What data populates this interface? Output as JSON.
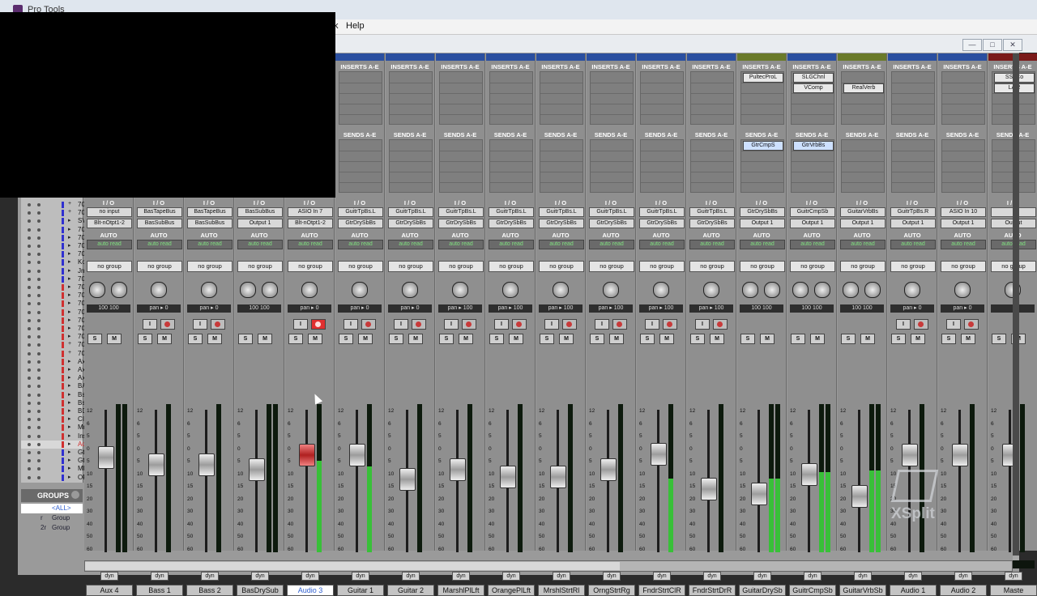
{
  "app": {
    "title": "Pro Tools",
    "menu_help": "Help",
    "menu_prev_char": "k"
  },
  "window_buttons": {
    "minimize": "—",
    "restore": "□",
    "close": "✕"
  },
  "section_headers": {
    "inserts": "INSERTS A-E",
    "sends": "SENDS A-E",
    "io": "I / O",
    "auto": "AUTO"
  },
  "auto_mode": "auto read",
  "group_label": "no group",
  "button_labels": {
    "input": "I",
    "solo": "S",
    "mute": "M"
  },
  "dyn_label": "dyn",
  "colors": {
    "accent_blue": "#2a4fa0",
    "meter_green": "#38c038",
    "selected_red": "#d03030",
    "olive": "#6a7a2a",
    "maroon": "#7a1a1a"
  },
  "track_list": [
    {
      "name": "700",
      "color": "#3030d0",
      "marker": "+"
    },
    {
      "name": "700",
      "color": "#3030d0",
      "marker": "+"
    },
    {
      "name": "SV",
      "color": "#3030d0",
      "marker": "▸"
    },
    {
      "name": "700",
      "color": "#3030d0",
      "marker": "▸"
    },
    {
      "name": "700",
      "color": "#3030d0",
      "marker": "▸"
    },
    {
      "name": "700",
      "color": "#3030d0",
      "marker": "▸"
    },
    {
      "name": "700",
      "color": "#3030d0",
      "marker": "▸"
    },
    {
      "name": "KcF",
      "color": "#3030d0",
      "marker": "▸"
    },
    {
      "name": "JnK",
      "color": "#3030d0",
      "marker": "▸"
    },
    {
      "name": "700",
      "color": "#3030d0",
      "marker": "▸"
    },
    {
      "name": "700",
      "color": "#d03030",
      "marker": "▸"
    },
    {
      "name": "700",
      "color": "#d03030",
      "marker": "▸"
    },
    {
      "name": "700",
      "color": "#d03030",
      "marker": "▸"
    },
    {
      "name": "700",
      "color": "#d03030",
      "marker": "▸"
    },
    {
      "name": "700",
      "color": "#d03030",
      "marker": "▸"
    },
    {
      "name": "700",
      "color": "#d03030",
      "marker": "▸"
    },
    {
      "name": "700",
      "color": "#d03030",
      "marker": "▸"
    },
    {
      "name": "700",
      "color": "#d03030",
      "marker": "+"
    },
    {
      "name": "700",
      "color": "#d03030",
      "marker": "+"
    },
    {
      "name": "Ax2",
      "color": "#d03030",
      "marker": "▸"
    },
    {
      "name": "Ax3",
      "color": "#d03030",
      "marker": "▸"
    },
    {
      "name": "Ax4",
      "color": "#d03030",
      "marker": "▸"
    },
    {
      "name": "BA",
      "color": "#d03030",
      "marker": "▸"
    },
    {
      "name": "Bs1",
      "color": "#d03030",
      "marker": "▸"
    },
    {
      "name": "Bs2",
      "color": "#d03030",
      "marker": "▸"
    },
    {
      "name": "BD",
      "color": "#d03030",
      "marker": "▸"
    },
    {
      "name": "CIF",
      "color": "#d03030",
      "marker": "▸"
    },
    {
      "name": "MrV",
      "color": "#d03030",
      "marker": "▸"
    },
    {
      "name": "Ins4",
      "color": "#d03030",
      "marker": "▸"
    },
    {
      "name": "Ad3",
      "color": "#d03030",
      "marker": "▸"
    },
    {
      "name": "Gt1",
      "color": "#3030d0",
      "marker": "▸"
    },
    {
      "name": "Gt2",
      "color": "#3030d0",
      "marker": "▸"
    },
    {
      "name": "MP",
      "color": "#3030d0",
      "marker": "▸"
    },
    {
      "name": "OP",
      "color": "#3030d0",
      "marker": "▸"
    }
  ],
  "groups": {
    "title": "GROUPS",
    "items": [
      {
        "id": "",
        "name": "<ALL>"
      },
      {
        "id": "r",
        "name": "Group"
      },
      {
        "id": "2r",
        "name": "Group"
      }
    ]
  },
  "strips": [
    {
      "name": "Aux 4",
      "top_color": "#2a4fa0",
      "input": "no input",
      "output": "Blt-nOtpt1-2",
      "pan_text": "100  100",
      "stereo": true,
      "fader": 0.3,
      "meter": 0.0,
      "vol_left": "0.0",
      "vol_right": "",
      "inserts": [],
      "sends": [],
      "has_rec": false,
      "selected": false
    },
    {
      "name": "Bass 1",
      "top_color": "#2a4fa0",
      "input": "BasTapeBus",
      "output": "BasSubBus",
      "pan_text": "pan ▸ 0",
      "stereo": false,
      "fader": 0.36,
      "meter": 0.0,
      "vol_left": "-4.6",
      "vol_right": "-0.9",
      "inserts": [],
      "sends": [],
      "has_rec": true,
      "selected": false
    },
    {
      "name": "Bass 2",
      "top_color": "#2a4fa0",
      "input": "BasTapeBus",
      "output": "BasSubBus",
      "pan_text": "pan ▸ 0",
      "stereo": false,
      "fader": 0.36,
      "meter": 0.0,
      "vol_left": "-4.9",
      "vol_right": "-5.7",
      "inserts": [],
      "sends": [],
      "has_rec": true,
      "selected": false
    },
    {
      "name": "BasDrySub",
      "top_color": "#2a4fa0",
      "input": "BasSubBus",
      "output": "Output 1",
      "pan_text": "100  100",
      "stereo": true,
      "fader": 0.4,
      "meter": 0.0,
      "vol_left": "-5.9",
      "vol_right": "-1.4",
      "inserts": [],
      "sends": [],
      "has_rec": false,
      "selected": false
    },
    {
      "name": "Audio 3",
      "top_color": "#2a4fa0",
      "input": "ASIO In 7",
      "output": "Blt-nOtpt1-2",
      "pan_text": "pan ▸ 0",
      "stereo": false,
      "fader": 0.28,
      "meter": 0.62,
      "vol_left": "-0.4",
      "vol_right": "-0.0",
      "inserts": [],
      "sends": [],
      "has_rec": true,
      "rec_on": true,
      "selected": true
    },
    {
      "name": "Guitar 1",
      "top_color": "#2a4fa0",
      "input": "GuitrTpBs.L",
      "output": "GtrDrySbBs",
      "pan_text": "pan ▸ 0",
      "stereo": false,
      "fader": 0.28,
      "meter": 0.58,
      "vol_left": "-0.1",
      "vol_right": "-5.1",
      "inserts": [],
      "sends": [],
      "has_rec": true,
      "selected": false
    },
    {
      "name": "Guitar 2",
      "top_color": "#2a4fa0",
      "input": "GuitrTpBs.L",
      "output": "GtrDrySbBs",
      "pan_text": "pan ▸ 0",
      "stereo": false,
      "fader": 0.48,
      "meter": 0.0,
      "vol_left": "-12.9",
      "vol_right": "-5.1",
      "inserts": [],
      "sends": [],
      "has_rec": true,
      "selected": false
    },
    {
      "name": "MarshlPlLft",
      "top_color": "#2a4fa0",
      "input": "GuitrTpBs.L",
      "output": "GtrDrySbBs",
      "pan_text": "pan ▸ 100",
      "stereo": false,
      "fader": 0.4,
      "meter": 0.0,
      "vol_left": "-7.0",
      "vol_right": "-3.4",
      "inserts": [],
      "sends": [],
      "has_rec": true,
      "selected": false
    },
    {
      "name": "OrangePlLft",
      "top_color": "#2a4fa0",
      "input": "GuitrTpBs.L",
      "output": "GtrDrySbBs",
      "pan_text": "pan ▸ 100",
      "stereo": false,
      "fader": 0.46,
      "meter": 0.0,
      "vol_left": "-14.0",
      "vol_right": "-4.4",
      "inserts": [],
      "sends": [],
      "has_rec": true,
      "selected": false
    },
    {
      "name": "MrshlStrtRl",
      "top_color": "#2a4fa0",
      "input": "GuitrTpBs.L",
      "output": "GtrDrySbBs",
      "pan_text": "pan ▸ 100",
      "stereo": false,
      "fader": 0.46,
      "meter": 0.0,
      "vol_left": "-14.0",
      "vol_right": "-4.6",
      "inserts": [],
      "sends": [],
      "has_rec": true,
      "selected": false
    },
    {
      "name": "OrngStrtRg",
      "top_color": "#2a4fa0",
      "input": "GuitrTpBs.L",
      "output": "GtrDrySbBs",
      "pan_text": "pan ▸ 100",
      "stereo": false,
      "fader": 0.4,
      "meter": 0.0,
      "vol_left": "-7.0",
      "vol_right": "-2.8",
      "inserts": [],
      "sends": [],
      "has_rec": true,
      "selected": false
    },
    {
      "name": "FndrStrtClR",
      "top_color": "#2a4fa0",
      "input": "GuitrTpBs.L",
      "output": "GtrDrySbBs",
      "pan_text": "pan ▸ 100",
      "stereo": false,
      "fader": 0.27,
      "meter": 0.5,
      "vol_left": "-0.1",
      "vol_right": "-4.2",
      "inserts": [],
      "sends": [],
      "has_rec": true,
      "selected": false
    },
    {
      "name": "FndrStrtDrR",
      "top_color": "#2a4fa0",
      "input": "GuitrTpBs.L",
      "output": "GtrDrySbBs",
      "pan_text": "pan ▸ 100",
      "stereo": false,
      "fader": 0.56,
      "meter": 0.0,
      "vol_left": "-19.5",
      "vol_right": "-3.0",
      "inserts": [],
      "sends": [],
      "has_rec": true,
      "selected": false
    },
    {
      "name": "GuitarDrySb",
      "top_color": "#6a7a2a",
      "input": "GtrDrySbBs",
      "output": "Output 1",
      "pan_text": "100  100",
      "stereo": true,
      "fader": 0.6,
      "meter": 0.5,
      "vol_left": "-23.1",
      "vol_right": "-3.3",
      "inserts": [
        "PultecProL"
      ],
      "sends": [
        "GtrCmpS"
      ],
      "has_rec": false,
      "selected": false
    },
    {
      "name": "GuitrCmpSb",
      "top_color": "#2a4fa0",
      "input": "GuitrCmpSb",
      "output": "Output 1",
      "pan_text": "100  100",
      "stereo": true,
      "fader": 0.44,
      "meter": 0.54,
      "vol_left": "-9.4",
      "vol_right": "-6.2",
      "inserts": [
        "SLGChnl",
        "VComp"
      ],
      "sends": [
        "GtrVrbBs"
      ],
      "has_rec": false,
      "selected": false
    },
    {
      "name": "GuitarVrbSb",
      "top_color": "#6a7a2a",
      "input": "GuitarVrbBs",
      "output": "Output 1",
      "pan_text": "100  100",
      "stereo": true,
      "fader": 0.62,
      "meter": 0.55,
      "vol_left": "-23.9",
      "vol_right": "-7.2",
      "inserts": [
        "",
        "RealVerb"
      ],
      "sends": [],
      "has_rec": false,
      "selected": false
    },
    {
      "name": "Audio 1",
      "top_color": "#2a4fa0",
      "input": "GuitrTpBs.R",
      "output": "Output 1",
      "pan_text": "pan ▸ 0",
      "stereo": false,
      "fader": 0.28,
      "meter": 0.0,
      "vol_left": "0.0",
      "vol_right": "",
      "inserts": [],
      "sends": [],
      "has_rec": true,
      "selected": false
    },
    {
      "name": "Audio 2",
      "top_color": "#2a4fa0",
      "input": "ASIO In 10",
      "output": "Output 1",
      "pan_text": "pan ▸ 0",
      "stereo": false,
      "fader": 0.28,
      "meter": 0.0,
      "vol_left": "0.0",
      "vol_right": "",
      "inserts": [],
      "sends": [],
      "has_rec": true,
      "selected": false
    },
    {
      "name": "Maste",
      "top_color": "#7a1a1a",
      "input": "",
      "output": "Output",
      "pan_text": "",
      "stereo": false,
      "fader": 0.28,
      "meter": 0.0,
      "vol_left": "0.0",
      "vol_right": "",
      "inserts": [
        "SSLCo",
        "LA-2"
      ],
      "sends": [],
      "has_rec": false,
      "selected": false
    }
  ],
  "fader_scale": [
    "12",
    "6",
    "5",
    "0",
    "5",
    "10",
    "15",
    "20",
    "30",
    "40",
    "50",
    "60"
  ],
  "watermark": "XSplit"
}
